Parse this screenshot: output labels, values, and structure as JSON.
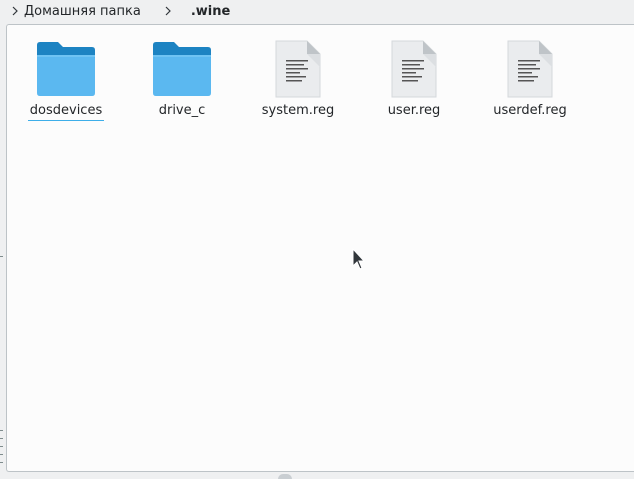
{
  "breadcrumb": {
    "items": [
      {
        "label": "Домашняя папка",
        "current": false
      },
      {
        "label": ".wine",
        "current": true
      }
    ]
  },
  "files": [
    {
      "name": "dosdevices",
      "type": "folder",
      "focused": true
    },
    {
      "name": "drive_c",
      "type": "folder",
      "focused": false
    },
    {
      "name": "system.reg",
      "type": "text-document",
      "focused": false
    },
    {
      "name": "user.reg",
      "type": "text-document",
      "focused": false
    },
    {
      "name": "userdef.reg",
      "type": "text-document",
      "focused": false
    }
  ],
  "colors": {
    "folder_front": "#5bb8f0",
    "folder_back": "#1d83c2",
    "focus_underline": "#3daee9",
    "view_background": "#fcfcfc"
  },
  "icons": {
    "folder": "folder-icon",
    "document": "text-document-icon",
    "separator": "chevron-right-icon",
    "pointer": "mouse-pointer-icon"
  }
}
